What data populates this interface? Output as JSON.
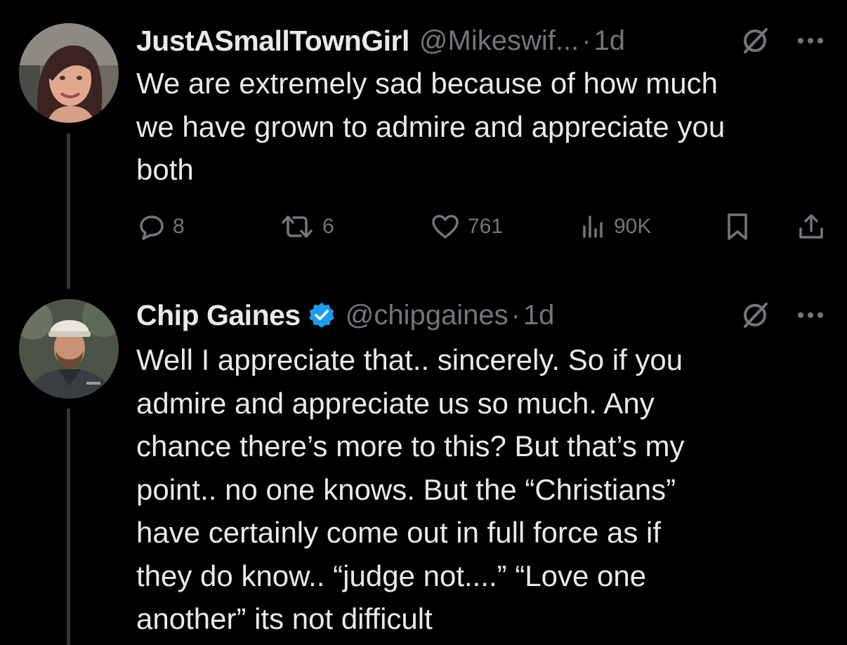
{
  "tweets": [
    {
      "display_name": "JustASmallTownGirl",
      "handle": "@Mikeswif...",
      "separator": "·",
      "time": "1d",
      "verified": false,
      "text": "We are extremely sad because of how much\nwe have grown to admire and appreciate you\nboth",
      "stats": {
        "replies": "8",
        "retweets": "6",
        "likes": "761",
        "views": "90K"
      },
      "icons": [
        "grok-icon",
        "more-icon",
        "reply-icon",
        "retweet-icon",
        "like-icon",
        "views-icon",
        "bookmark-icon",
        "share-icon"
      ]
    },
    {
      "display_name": "Chip Gaines",
      "handle": "@chipgaines",
      "separator": "·",
      "time": "1d",
      "verified": true,
      "text": "Well I appreciate that.. sincerely. So if you\nadmire and appreciate us so much. Any\nchance there’s more to this? But that’s my\npoint.. no one knows. But the “Christians”\nhave certainly come out in full force as if\nthey do know.. “judge not....” “Love one\nanother” its not difficult",
      "icons": [
        "verified-badge-icon",
        "grok-icon",
        "more-icon"
      ]
    }
  ],
  "colors": {
    "background": "#000000",
    "primary_text": "#e7e9ea",
    "secondary_text": "#71767b",
    "verified_blue": "#1d9bf0",
    "thread_line": "#333639"
  }
}
